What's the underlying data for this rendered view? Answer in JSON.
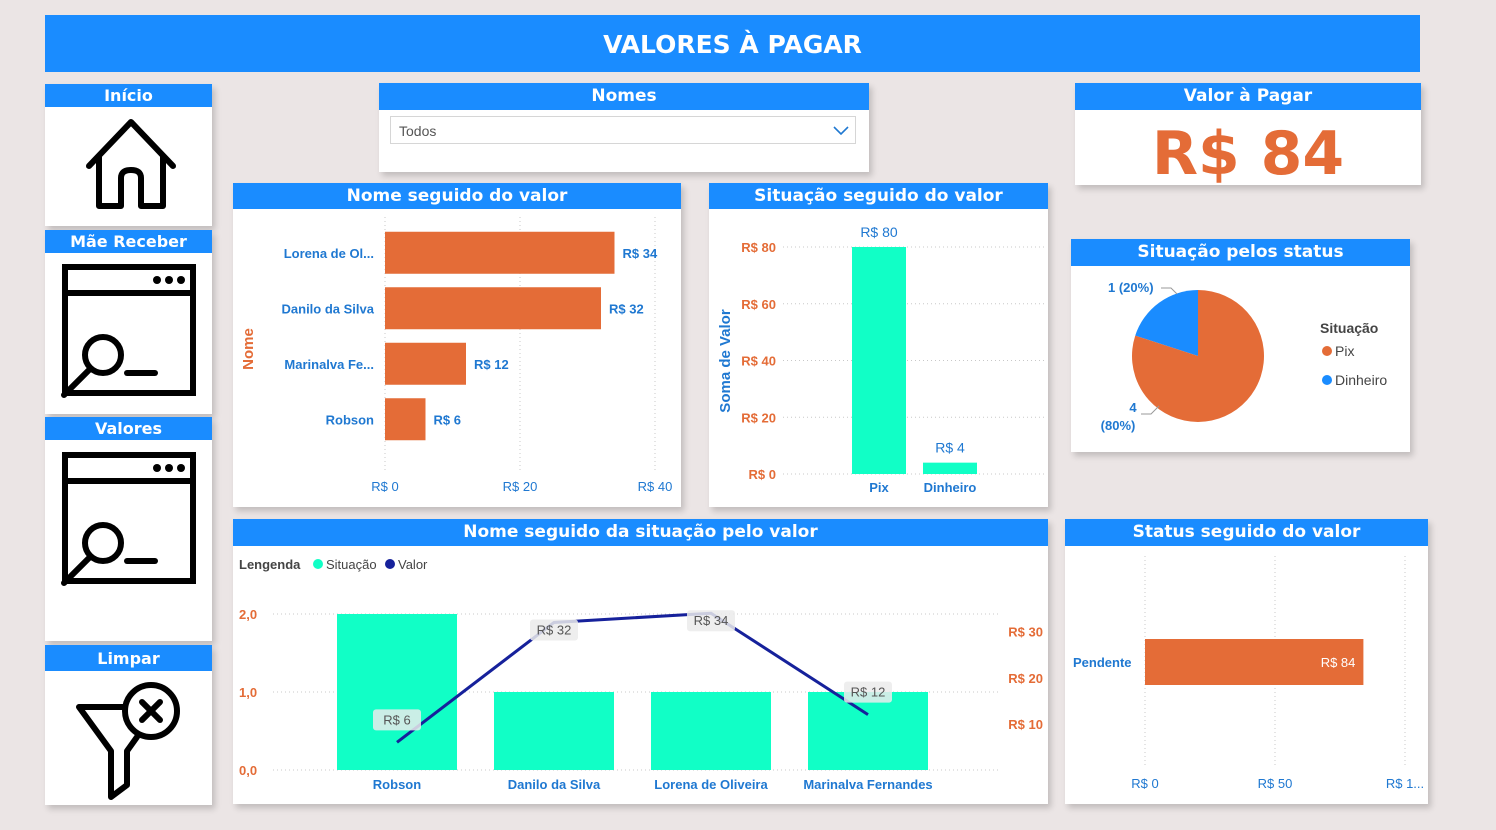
{
  "title": "VALORES À PAGAR",
  "nav": {
    "inicio": "Início",
    "mae_receber": "Mãe Receber",
    "valores": "Valores",
    "limpar": "Limpar"
  },
  "slicer": {
    "title": "Nomes",
    "value": "Todos"
  },
  "kpi": {
    "title": "Valor à Pagar",
    "value": "R$ 84"
  },
  "colors": {
    "header": "#1a8cff",
    "orange": "#e46c37",
    "teal": "#11ffc6",
    "navy": "#16219b",
    "blue_text": "#1f78d1"
  },
  "icons": [
    "home-icon",
    "window-search-icon",
    "window-search-icon",
    "filter-clear-icon",
    "chevron-down-icon"
  ],
  "chart_data": [
    {
      "id": "nome-valor",
      "type": "bar",
      "orientation": "horizontal",
      "title": "Nome seguido do valor",
      "ylabel": "Nome",
      "categories": [
        "Lorena de Ol...",
        "Danilo da Silva",
        "Marinalva Fe...",
        "Robson"
      ],
      "values": [
        34,
        32,
        12,
        6
      ],
      "data_labels": [
        "R$ 34",
        "R$ 32",
        "R$ 12",
        "R$ 6"
      ],
      "xlim": [
        0,
        40
      ],
      "ticks": [
        0,
        20,
        40
      ],
      "tick_labels": [
        "R$ 0",
        "R$ 20",
        "R$ 40"
      ]
    },
    {
      "id": "situacao-valor",
      "type": "bar",
      "title": "Situação seguido do valor",
      "ylabel": "Soma de Valor",
      "categories": [
        "Pix",
        "Dinheiro"
      ],
      "values": [
        80,
        4
      ],
      "data_labels": [
        "R$ 80",
        "R$ 4"
      ],
      "ylim": [
        0,
        80
      ],
      "ticks": [
        0,
        20,
        40,
        60,
        80
      ],
      "tick_labels": [
        "R$ 0",
        "R$ 20",
        "R$ 40",
        "R$ 60",
        "R$ 80"
      ]
    },
    {
      "id": "situacao-status",
      "type": "pie",
      "title": "Situação pelos status",
      "legend_title": "Situação",
      "legend_position": "right",
      "slices": [
        {
          "label": "Pix",
          "value": 4,
          "label_top": "4",
          "label_bottom": "(80%)"
        },
        {
          "label": "Dinheiro",
          "value": 1,
          "label_top": "1 (20%)",
          "label_bottom": ""
        }
      ]
    },
    {
      "id": "nome-situacao-valor",
      "type": "bar",
      "title": "Nome seguido da situação pelo valor",
      "legend_label": "Lengenda",
      "legend_position": "top-left",
      "categories": [
        "Robson",
        "Danilo da Silva",
        "Lorena de Oliveira",
        "Marinalva Fernandes"
      ],
      "series": [
        {
          "name": "Situação",
          "type": "bar",
          "values": [
            2,
            1,
            1,
            1
          ]
        },
        {
          "name": "Valor",
          "type": "line",
          "values": [
            6,
            32,
            34,
            12
          ],
          "data_labels": [
            "R$ 6",
            "R$ 32",
            "R$ 34",
            "R$ 12"
          ]
        }
      ],
      "ylim_left": [
        0,
        2
      ],
      "ticks_left": [
        0,
        1,
        2
      ],
      "tick_labels_left": [
        "0,0",
        "1,0",
        "2,0"
      ],
      "ylim_right": [
        0,
        36
      ],
      "ticks_right": [
        10,
        20,
        30
      ],
      "tick_labels_right": [
        "R$ 10",
        "R$ 20",
        "R$ 30"
      ]
    },
    {
      "id": "status-valor",
      "type": "bar",
      "orientation": "horizontal",
      "title": "Status seguido do valor",
      "categories": [
        "Pendente"
      ],
      "values": [
        84
      ],
      "data_labels": [
        "R$ 84"
      ],
      "xlim": [
        0,
        100
      ],
      "ticks": [
        0,
        50,
        100
      ],
      "tick_labels": [
        "R$ 0",
        "R$ 50",
        "R$ 1..."
      ]
    }
  ]
}
